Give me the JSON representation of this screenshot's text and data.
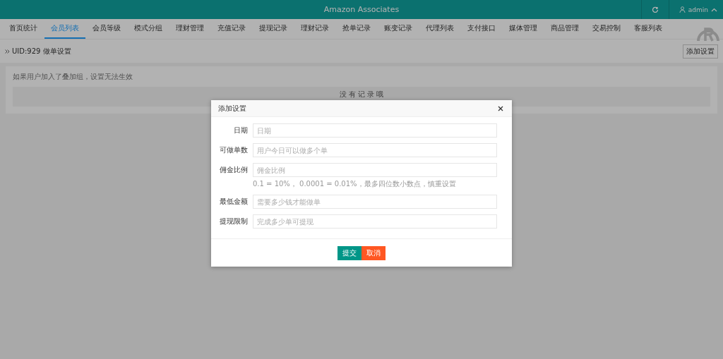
{
  "header": {
    "title": "Amazon Associates",
    "user": "admin"
  },
  "tabs": [
    {
      "label": "首页统计",
      "selected": false
    },
    {
      "label": "会员列表",
      "selected": true
    },
    {
      "label": "会员等级",
      "selected": false
    },
    {
      "label": "模式分组",
      "selected": false
    },
    {
      "label": "理财管理",
      "selected": false
    },
    {
      "label": "充值记录",
      "selected": false
    },
    {
      "label": "提现记录",
      "selected": false
    },
    {
      "label": "理财记录",
      "selected": false
    },
    {
      "label": "抢单记录",
      "selected": false
    },
    {
      "label": "账变记录",
      "selected": false
    },
    {
      "label": "代理列表",
      "selected": false
    },
    {
      "label": "支付接口",
      "selected": false
    },
    {
      "label": "媒体管理",
      "selected": false
    },
    {
      "label": "商品管理",
      "selected": false
    },
    {
      "label": "交易控制",
      "selected": false
    },
    {
      "label": "客服列表",
      "selected": false
    }
  ],
  "breadcrumb": "UID:929 做单设置",
  "add_button": "添加设置",
  "notice": "如果用户加入了叠加组，设置无法生效",
  "empty": "没 有 记 录 哦",
  "dialog": {
    "title": "添加设置",
    "fields": [
      {
        "label": "日期",
        "placeholder": "日期"
      },
      {
        "label": "可做单数",
        "placeholder": "用户今日可以做多个单"
      },
      {
        "label": "佣金比例",
        "placeholder": "佣金比例",
        "help": "0.1 = 10%， 0.0001 = 0.01%，最多四位数小数点，慎重设置"
      },
      {
        "label": "最低金额",
        "placeholder": "需要多少钱才能做单"
      },
      {
        "label": "提现限制",
        "placeholder": "完成多少单可提现"
      }
    ],
    "submit": "提交",
    "cancel": "取消"
  }
}
